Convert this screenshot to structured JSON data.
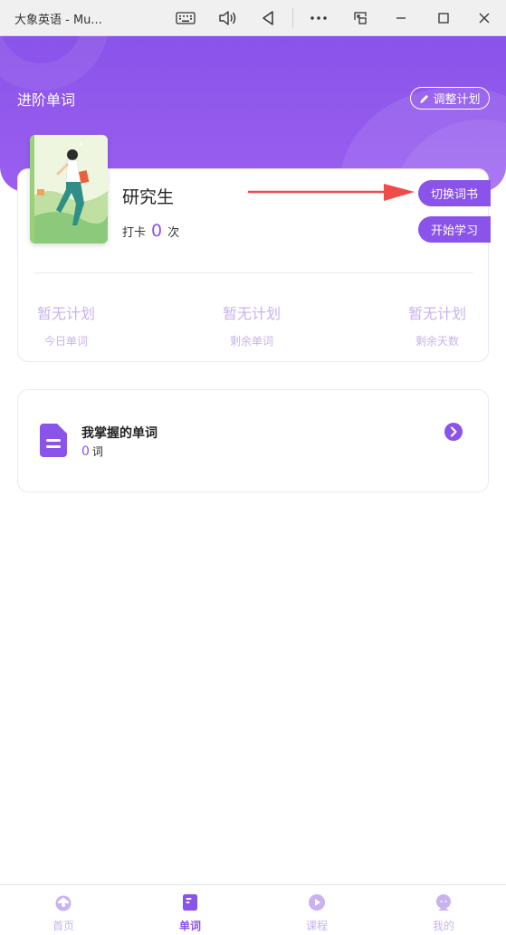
{
  "window": {
    "title": "大象英语 - Mu..."
  },
  "header": {
    "title": "进阶单词",
    "adjust_label": "调整计划"
  },
  "book": {
    "name": "研究生",
    "checkin_prefix": "打卡",
    "checkin_count": "0",
    "checkin_suffix": "次"
  },
  "actions": {
    "switch_label": "切换词书",
    "start_label": "开始学习"
  },
  "stats": [
    {
      "value": "暂无计划",
      "label": "今日单词"
    },
    {
      "value": "暂无计划",
      "label": "剩余单词"
    },
    {
      "value": "暂无计划",
      "label": "剩余天数"
    }
  ],
  "mastered": {
    "title": "我掌握的单词",
    "count": "0",
    "unit": "词"
  },
  "nav": [
    {
      "label": "首页",
      "icon": "home-icon"
    },
    {
      "label": "单词",
      "icon": "word-book-icon"
    },
    {
      "label": "课程",
      "icon": "play-icon"
    },
    {
      "label": "我的",
      "icon": "profile-icon"
    }
  ],
  "colors": {
    "primary": "#8a53e9",
    "muted": "#c9b3ef",
    "annotation": "#f04a4a"
  }
}
